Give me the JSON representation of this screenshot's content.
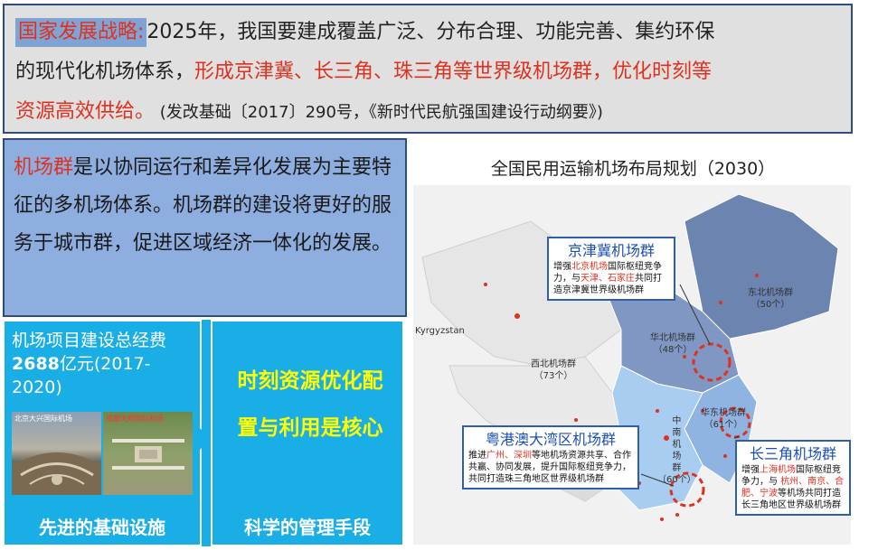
{
  "top": {
    "tag": "国家发展战略:",
    "line1": "2025年，我国要建成覆盖广泛、分布合理、功能完善、集约环保",
    "line2_black": "的现代化机场体系，",
    "line2_red": "形成京津冀、长三角、珠三角等世界级机场群，优化时刻等",
    "line3_red": "资源高效供给。",
    "line3_source": " (发改基础〔2017〕290号，《新时代民航强国建设行动纲要》)"
  },
  "definition": {
    "term": "机场群",
    "text": "是以协同运行和差异化发展为主要特征的多机场体系。机场群的建设将更好的服务于城市群，促进区域经济一体化的发展。"
  },
  "panels": {
    "invest_prefix": "机场项目建设总经费",
    "invest_amount": "2688",
    "invest_suffix": "亿元(2017-2020)",
    "photo1_label": "北京大兴国际机场",
    "photo2_label": "成都天府国际机场",
    "infra_label": "先进的基础设施",
    "core_line1": "时刻资源优化配",
    "core_line2": "置与利用是核心",
    "mgmt_label": "科学的管理手段"
  },
  "map": {
    "title": "全国民用运输机场布局规划（2030）",
    "labels": {
      "kyrgyzstan": "Kyrgyzstan",
      "northeast": "东北机场群",
      "northeast_count": "（50个）",
      "north": "华北机场群",
      "north_count": "（48个）",
      "northwest": "西北机场群",
      "northwest_count": "（73个）",
      "east": "华东机场群",
      "east_count": "（61个）",
      "central_south_1": "中",
      "central_south_2": "南",
      "central_south_3": "机",
      "central_south_4": "场",
      "central_south_5": "群",
      "central_south_count": "（60个）"
    },
    "callouts": {
      "jjj": {
        "title": "京津冀机场群",
        "p1": "增强",
        "r1": "北京机场",
        "p2": "国际枢纽竞争力，与",
        "r2": "天津、石家庄",
        "p3": "共同打造京津冀世界级机场群"
      },
      "gba": {
        "title": "粤港澳大湾区机场群",
        "p1": "推进",
        "r1": "广州、深圳",
        "p2": "等地机场资源共享、合作共赢、协同发展，提升国际枢纽竞争力，共同打造珠三角地区世界级机场群"
      },
      "yrd": {
        "title": "长三角机场群",
        "p1": "增强",
        "r1": "上海机场",
        "p2": "国际枢纽竞争力，与 ",
        "r2": "杭州、南京、合肥、宁波",
        "p3": "等机场共同打造长三角地区世界级机场群"
      }
    }
  },
  "colors": {
    "accent_red": "#e0301e",
    "panel_cyan": "#1aaee6",
    "def_blue": "#8eaee0",
    "highlight_yellow": "#ffff00"
  }
}
